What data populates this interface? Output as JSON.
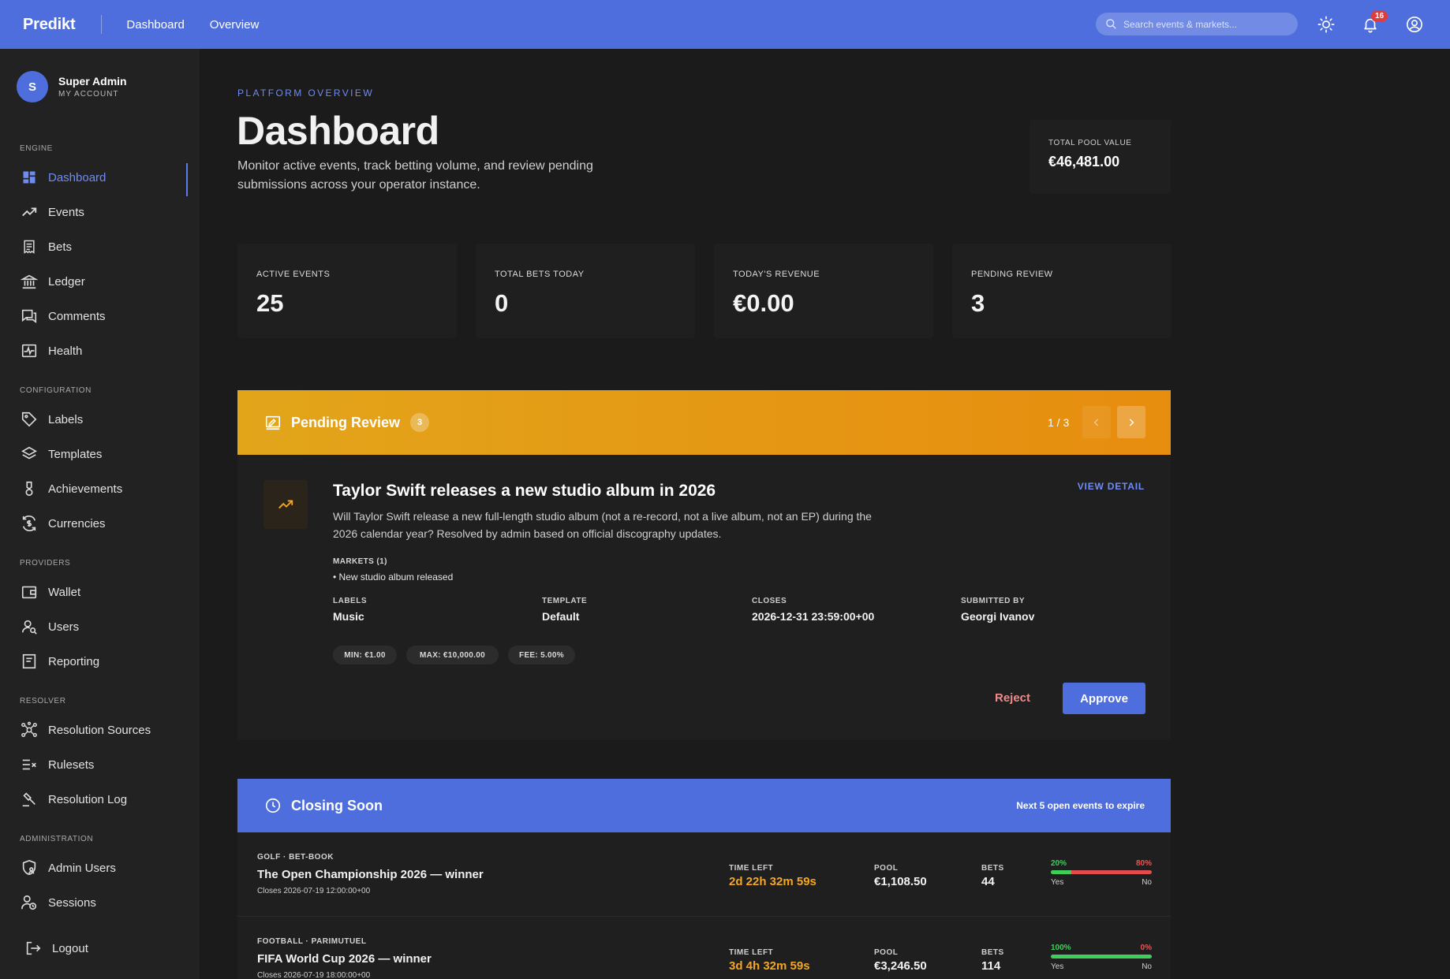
{
  "topbar": {
    "brand": "Predikt",
    "nav": [
      "Dashboard",
      "Overview"
    ],
    "search_placeholder": "Search events & markets...",
    "notification_count": "16",
    "color": "#4f6ede"
  },
  "sidebar": {
    "account": {
      "initial": "S",
      "name": "Super Admin",
      "sub": "MY ACCOUNT"
    },
    "sections": {
      "engine": "ENGINE",
      "configuration": "CONFIGURATION",
      "providers": "PROVIDERS",
      "resolver": "RESOLVER",
      "administration": "ADMINISTRATION"
    },
    "items": [
      {
        "label": "Dashboard",
        "icon": "grid-icon",
        "active": true
      },
      {
        "label": "Events",
        "icon": "trending-up-icon"
      },
      {
        "label": "Bets",
        "icon": "receipt-icon"
      },
      {
        "label": "Ledger",
        "icon": "bank-icon"
      },
      {
        "label": "Comments",
        "icon": "chat-icon"
      },
      {
        "label": "Health",
        "icon": "pulse-icon"
      },
      {
        "label": "Labels",
        "icon": "tag-icon"
      },
      {
        "label": "Templates",
        "icon": "layers-icon"
      },
      {
        "label": "Achievements",
        "icon": "medal-icon"
      },
      {
        "label": "Currencies",
        "icon": "currency-exchange-icon"
      },
      {
        "label": "Wallet",
        "icon": "wallet-icon"
      },
      {
        "label": "Users",
        "icon": "user-search-icon"
      },
      {
        "label": "Reporting",
        "icon": "report-icon"
      },
      {
        "label": "Resolution Sources",
        "icon": "network-icon"
      },
      {
        "label": "Rulesets",
        "icon": "checklist-icon"
      },
      {
        "label": "Resolution Log",
        "icon": "gavel-icon"
      },
      {
        "label": "Admin Users",
        "icon": "shield-user-icon"
      },
      {
        "label": "Sessions",
        "icon": "user-clock-icon"
      }
    ],
    "logout": "Logout",
    "active_color": "#6f8cf3"
  },
  "header": {
    "eyebrow": "PLATFORM OVERVIEW",
    "title": "Dashboard",
    "description": "Monitor active events, track betting volume, and review pending submissions across your operator instance.",
    "pool": {
      "label": "TOTAL POOL VALUE",
      "value": "€46,481.00"
    }
  },
  "stats": [
    {
      "label": "ACTIVE EVENTS",
      "value": "25"
    },
    {
      "label": "TOTAL BETS TODAY",
      "value": "0"
    },
    {
      "label": "TODAY'S REVENUE",
      "value": "€0.00"
    },
    {
      "label": "PENDING REVIEW",
      "value": "3"
    }
  ],
  "pending": {
    "title": "Pending Review",
    "count": "3",
    "pager": "1 / 3",
    "event": {
      "title": "Taylor Swift releases a new studio album in 2026",
      "view_detail": "VIEW DETAIL",
      "description": "Will Taylor Swift release a new full-length studio album (not a re-record, not a live album, not an EP) during the 2026 calendar year? Resolved by admin based on official discography updates.",
      "markets_label": "MARKETS (1)",
      "markets": "• New studio album released",
      "meta": [
        {
          "label": "LABELS",
          "value": "Music"
        },
        {
          "label": "TEMPLATE",
          "value": "Default"
        },
        {
          "label": "CLOSES",
          "value": "2026-12-31 23:59:00+00"
        },
        {
          "label": "SUBMITTED BY",
          "value": "Georgi Ivanov"
        }
      ],
      "chips": [
        "MIN: €1.00",
        "MAX: €10,000.00",
        "FEE: 5.00%"
      ],
      "reject": "Reject",
      "approve": "Approve"
    },
    "accent": "#e2a51a"
  },
  "closing": {
    "title": "Closing Soon",
    "note": "Next 5 open events to expire",
    "rows": [
      {
        "tags": "GOLF  · BET-BOOK",
        "name": "The Open Championship 2026 — winner",
        "closes": "Closes 2026-07-19 12:00:00+00",
        "time_label": "TIME LEFT",
        "time": "2d 22h 32m 59s",
        "pool_label": "POOL",
        "pool": "€1,108.50",
        "bets_label": "BETS",
        "bets": "44",
        "yes_pct": "20%",
        "no_pct": "80%",
        "yes_fraction": 0.2,
        "yes_label": "Yes",
        "no_label": "No"
      },
      {
        "tags": "FOOTBALL  · PARIMUTUEL",
        "name": "FIFA World Cup 2026 — winner",
        "closes": "Closes 2026-07-19 18:00:00+00",
        "time_label": "TIME LEFT",
        "time": "3d 4h 32m 59s",
        "pool_label": "POOL",
        "pool": "€3,246.50",
        "bets_label": "BETS",
        "bets": "114",
        "yes_pct": "100%",
        "no_pct": "0%",
        "yes_fraction": 1.0,
        "yes_label": "Yes",
        "no_label": "No"
      }
    ]
  }
}
